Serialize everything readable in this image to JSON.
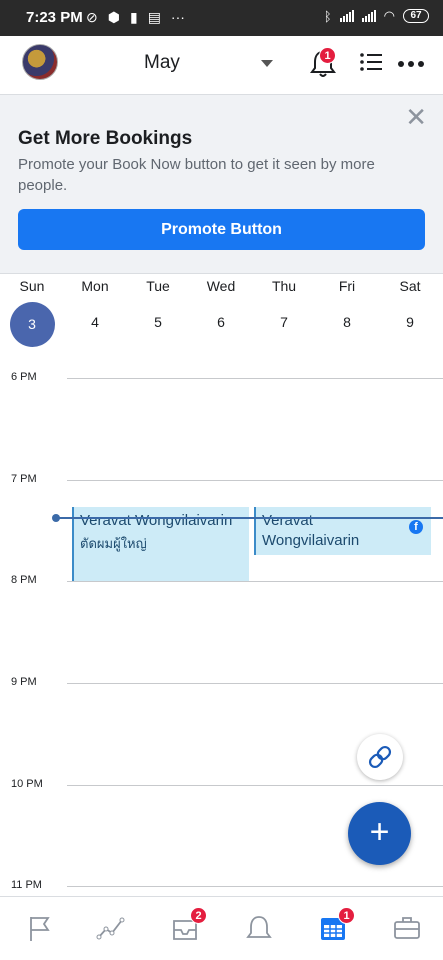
{
  "status_bar": {
    "time": "7:23 PM",
    "battery": "67"
  },
  "header": {
    "month": "May",
    "notification_count": "1"
  },
  "promo": {
    "title": "Get More Bookings",
    "text": "Promote your Book Now button to get it seen by more people.",
    "button": "Promote Button"
  },
  "week": {
    "days": [
      {
        "name": "Sun",
        "num": "3"
      },
      {
        "name": "Mon",
        "num": "4"
      },
      {
        "name": "Tue",
        "num": "5"
      },
      {
        "name": "Wed",
        "num": "6"
      },
      {
        "name": "Thu",
        "num": "7"
      },
      {
        "name": "Fri",
        "num": "8"
      },
      {
        "name": "Sat",
        "num": "9"
      }
    ]
  },
  "timeline": {
    "hours": [
      "6 PM",
      "7 PM",
      "8 PM",
      "9 PM",
      "10 PM",
      "11 PM"
    ]
  },
  "events": [
    {
      "name": "Veravat Wongvilaivarin",
      "subtitle": "ตัดผมผู้ใหญ่"
    },
    {
      "name": "Veravat Wongvilaivarin"
    }
  ],
  "bottom_nav": {
    "inbox_badge": "2",
    "calendar_badge": "1"
  },
  "colors": {
    "accent": "#1877f2",
    "selected_day": "#4a66ad",
    "event_bg": "#cdebf7",
    "fab": "#1b5bb8",
    "badge": "#e41e3f"
  }
}
